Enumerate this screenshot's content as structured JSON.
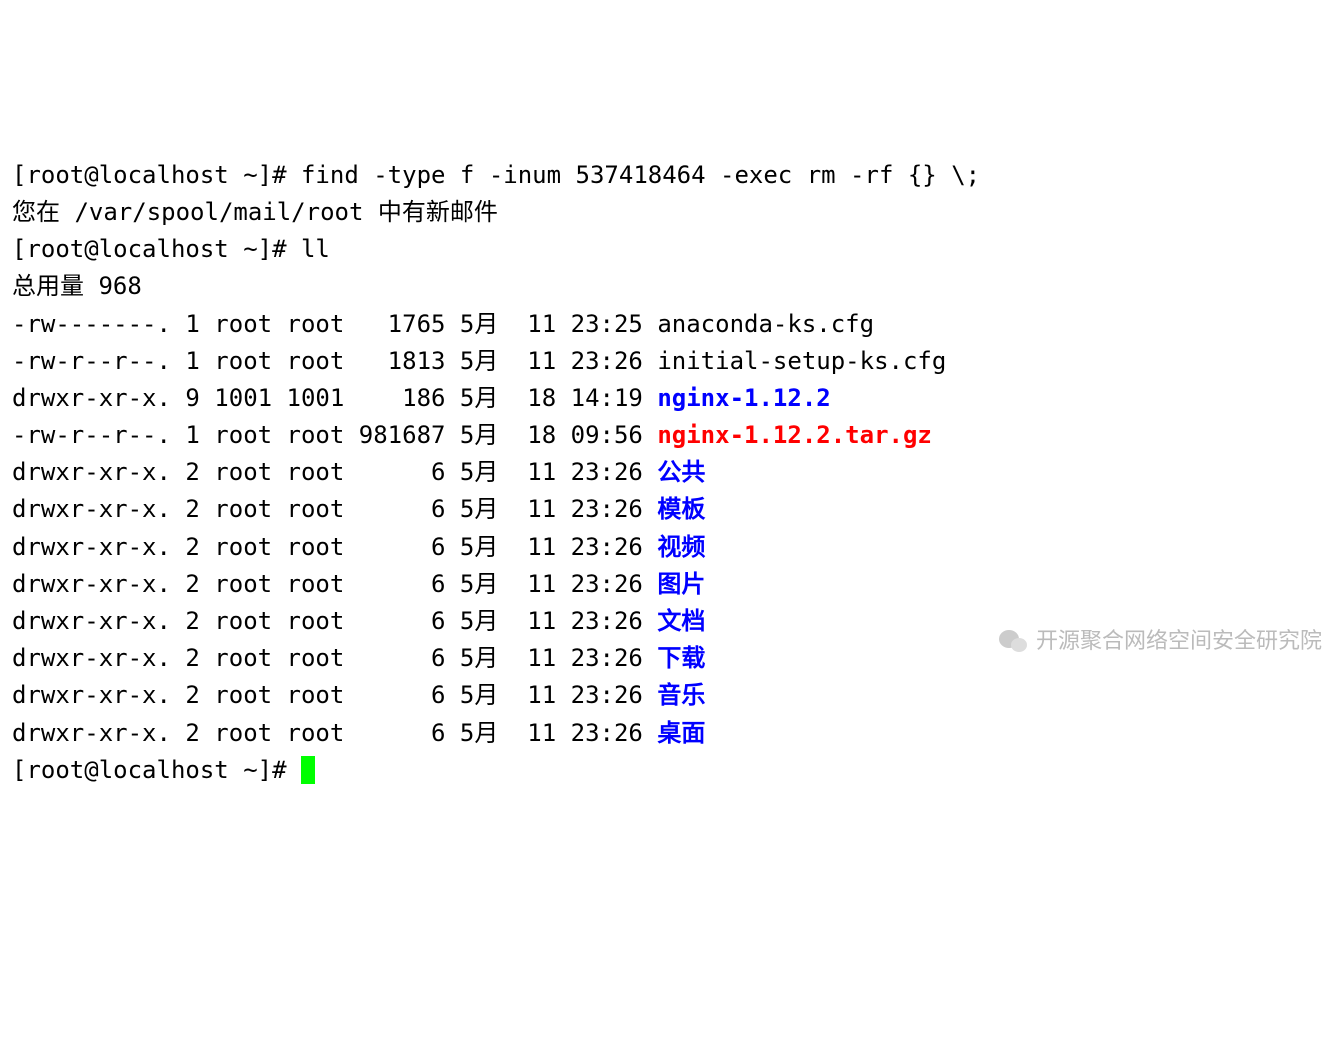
{
  "lines": {
    "prompt1_prefix": "[root@localhost ~]# ",
    "command1": "find -type f -inum 537418464 -exec rm -rf {} \\;",
    "mail_line": "您在 /var/spool/mail/root 中有新邮件",
    "prompt2_prefix": "[root@localhost ~]# ",
    "command2": "ll",
    "total_line": "总用量 968",
    "prompt3_prefix": "[root@localhost ~]# "
  },
  "listing": [
    {
      "perm": "-rw-------.",
      "links": "1",
      "owner": "root",
      "group": "root",
      "size": "1765",
      "month": "5月",
      "day": "11",
      "time": "23:25",
      "name": "anaconda-ks.cfg",
      "color": ""
    },
    {
      "perm": "-rw-r--r--.",
      "links": "1",
      "owner": "root",
      "group": "root",
      "size": "1813",
      "month": "5月",
      "day": "11",
      "time": "23:26",
      "name": "initial-setup-ks.cfg",
      "color": ""
    },
    {
      "perm": "drwxr-xr-x.",
      "links": "9",
      "owner": "1001",
      "group": "1001",
      "size": "186",
      "month": "5月",
      "day": "18",
      "time": "14:19",
      "name": "nginx-1.12.2",
      "color": "blue"
    },
    {
      "perm": "-rw-r--r--.",
      "links": "1",
      "owner": "root",
      "group": "root",
      "size": "981687",
      "month": "5月",
      "day": "18",
      "time": "09:56",
      "name": "nginx-1.12.2.tar.gz",
      "color": "red"
    },
    {
      "perm": "drwxr-xr-x.",
      "links": "2",
      "owner": "root",
      "group": "root",
      "size": "6",
      "month": "5月",
      "day": "11",
      "time": "23:26",
      "name": "公共",
      "color": "blue"
    },
    {
      "perm": "drwxr-xr-x.",
      "links": "2",
      "owner": "root",
      "group": "root",
      "size": "6",
      "month": "5月",
      "day": "11",
      "time": "23:26",
      "name": "模板",
      "color": "blue"
    },
    {
      "perm": "drwxr-xr-x.",
      "links": "2",
      "owner": "root",
      "group": "root",
      "size": "6",
      "month": "5月",
      "day": "11",
      "time": "23:26",
      "name": "视频",
      "color": "blue"
    },
    {
      "perm": "drwxr-xr-x.",
      "links": "2",
      "owner": "root",
      "group": "root",
      "size": "6",
      "month": "5月",
      "day": "11",
      "time": "23:26",
      "name": "图片",
      "color": "blue"
    },
    {
      "perm": "drwxr-xr-x.",
      "links": "2",
      "owner": "root",
      "group": "root",
      "size": "6",
      "month": "5月",
      "day": "11",
      "time": "23:26",
      "name": "文档",
      "color": "blue"
    },
    {
      "perm": "drwxr-xr-x.",
      "links": "2",
      "owner": "root",
      "group": "root",
      "size": "6",
      "month": "5月",
      "day": "11",
      "time": "23:26",
      "name": "下载",
      "color": "blue"
    },
    {
      "perm": "drwxr-xr-x.",
      "links": "2",
      "owner": "root",
      "group": "root",
      "size": "6",
      "month": "5月",
      "day": "11",
      "time": "23:26",
      "name": "音乐",
      "color": "blue"
    },
    {
      "perm": "drwxr-xr-x.",
      "links": "2",
      "owner": "root",
      "group": "root",
      "size": "6",
      "month": "5月",
      "day": "11",
      "time": "23:26",
      "name": "桌面",
      "color": "blue"
    }
  ],
  "watermark": "开源聚合网络空间安全研究院"
}
